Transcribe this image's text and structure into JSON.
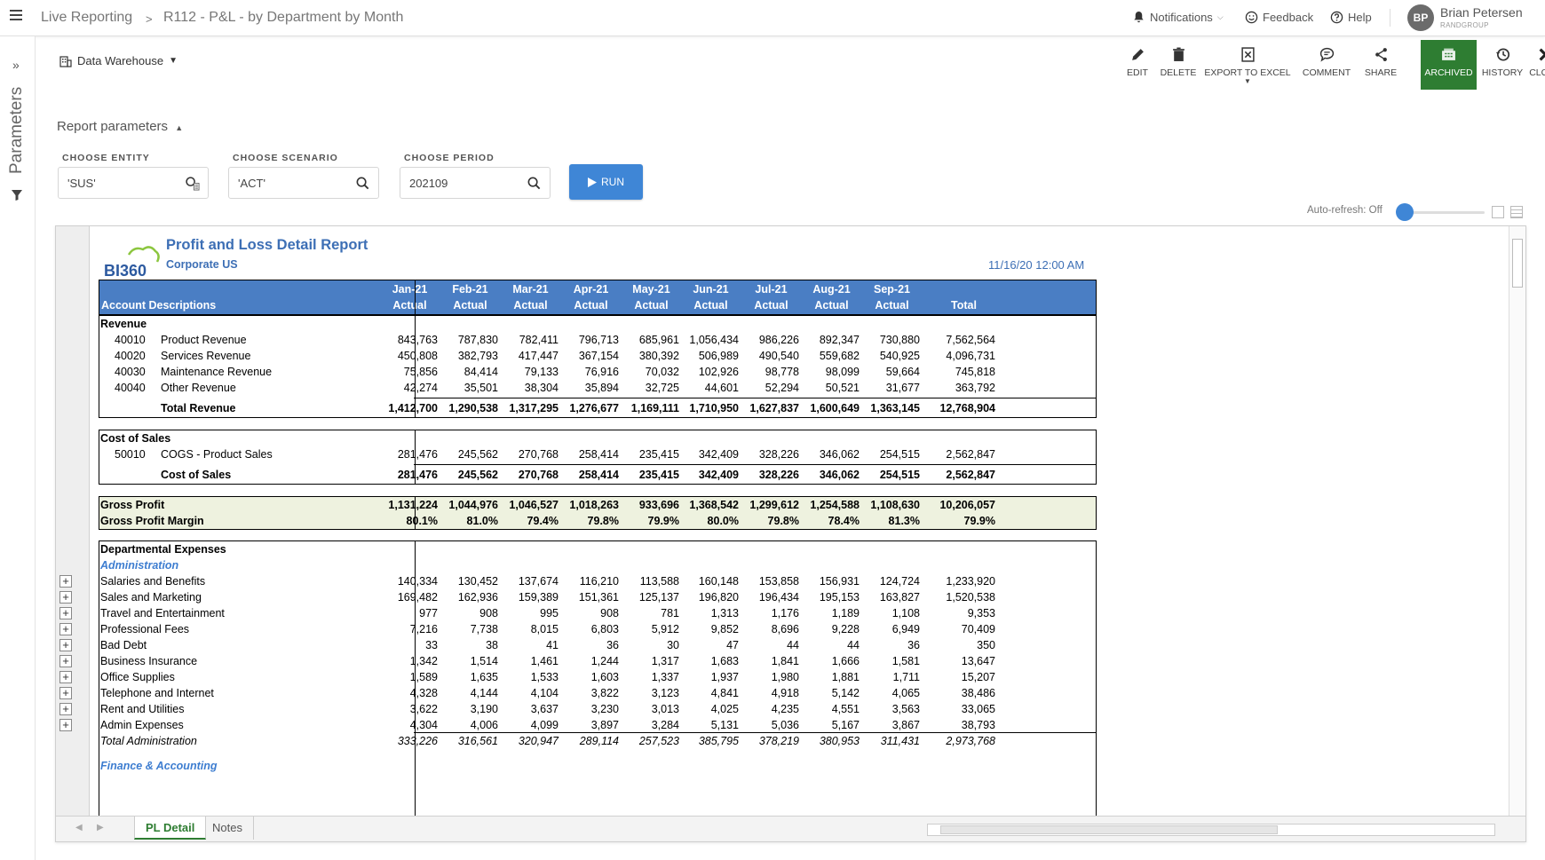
{
  "topbar": {
    "breadcrumb_root": "Live Reporting",
    "breadcrumb_sep": ">",
    "breadcrumb_current": "R112 - P&L - by Department by Month",
    "notifications": "Notifications",
    "feedback": "Feedback",
    "help": "Help",
    "user_initials": "BP",
    "user_name": "Brian Petersen",
    "user_org": "RANDGROUP"
  },
  "sidebar": {
    "label": "Parameters"
  },
  "toolbar": {
    "source": "Data Warehouse",
    "actions": [
      "EDIT",
      "DELETE",
      "EXPORT TO EXCEL",
      "COMMENT",
      "SHARE",
      "ARCHIVED",
      "HISTORY",
      "CLOSE"
    ]
  },
  "params": {
    "title": "Report parameters",
    "entity_label": "CHOOSE ENTITY",
    "entity_value": "'SUS'",
    "scenario_label": "CHOOSE SCENARIO",
    "scenario_value": "'ACT'",
    "period_label": "CHOOSE PERIOD",
    "period_value": "202109",
    "run_label": "RUN",
    "autorefresh": "Auto-refresh: Off"
  },
  "report": {
    "title": "Profit and Loss Detail Report",
    "subtitle": "Corporate US",
    "date": "11/16/20 12:00 AM",
    "logo_text": "BI360",
    "header_desc": "Account Descriptions",
    "months": [
      "Jan-21",
      "Feb-21",
      "Mar-21",
      "Apr-21",
      "May-21",
      "Jun-21",
      "Jul-21",
      "Aug-21",
      "Sep-21"
    ],
    "scenario": "Actual",
    "total_label": "Total",
    "revenue_title": "Revenue",
    "revenue_rows": [
      {
        "code": "40010",
        "name": "Product Revenue",
        "v": [
          "843,763",
          "787,830",
          "782,411",
          "796,713",
          "685,961",
          "1,056,434",
          "986,226",
          "892,347",
          "730,880",
          "7,562,564"
        ]
      },
      {
        "code": "40020",
        "name": "Services Revenue",
        "v": [
          "450,808",
          "382,793",
          "417,447",
          "367,154",
          "380,392",
          "506,989",
          "490,540",
          "559,682",
          "540,925",
          "4,096,731"
        ]
      },
      {
        "code": "40030",
        "name": "Maintenance Revenue",
        "v": [
          "75,856",
          "84,414",
          "79,133",
          "76,916",
          "70,032",
          "102,926",
          "98,778",
          "98,099",
          "59,664",
          "745,818"
        ]
      },
      {
        "code": "40040",
        "name": "Other Revenue",
        "v": [
          "42,274",
          "35,501",
          "38,304",
          "35,894",
          "32,725",
          "44,601",
          "52,294",
          "50,521",
          "31,677",
          "363,792"
        ]
      }
    ],
    "total_revenue": {
      "name": "Total Revenue",
      "v": [
        "1,412,700",
        "1,290,538",
        "1,317,295",
        "1,276,677",
        "1,169,111",
        "1,710,950",
        "1,627,837",
        "1,600,649",
        "1,363,145",
        "12,768,904"
      ]
    },
    "cos_title": "Cost of Sales",
    "cos_rows": [
      {
        "code": "50010",
        "name": "COGS - Product Sales",
        "v": [
          "281,476",
          "245,562",
          "270,768",
          "258,414",
          "235,415",
          "342,409",
          "328,226",
          "346,062",
          "254,515",
          "2,562,847"
        ]
      }
    ],
    "total_cos": {
      "name": "Cost of Sales",
      "v": [
        "281,476",
        "245,562",
        "270,768",
        "258,414",
        "235,415",
        "342,409",
        "328,226",
        "346,062",
        "254,515",
        "2,562,847"
      ]
    },
    "gross_profit": {
      "name": "Gross Profit",
      "v": [
        "1,131,224",
        "1,044,976",
        "1,046,527",
        "1,018,263",
        "933,696",
        "1,368,542",
        "1,299,612",
        "1,254,588",
        "1,108,630",
        "10,206,057"
      ]
    },
    "gross_margin": {
      "name": "Gross Profit Margin",
      "v": [
        "80.1%",
        "81.0%",
        "79.4%",
        "79.8%",
        "79.9%",
        "80.0%",
        "79.8%",
        "78.4%",
        "81.3%",
        "79.9%"
      ]
    },
    "dept_title": "Departmental Expenses",
    "admin_title": "Administration",
    "admin_rows": [
      {
        "name": "Salaries and Benefits",
        "v": [
          "140,334",
          "130,452",
          "137,674",
          "116,210",
          "113,588",
          "160,148",
          "153,858",
          "156,931",
          "124,724",
          "1,233,920"
        ]
      },
      {
        "name": "Sales and Marketing",
        "v": [
          "169,482",
          "162,936",
          "159,389",
          "151,361",
          "125,137",
          "196,820",
          "196,434",
          "195,153",
          "163,827",
          "1,520,538"
        ]
      },
      {
        "name": "Travel and Entertainment",
        "v": [
          "977",
          "908",
          "995",
          "908",
          "781",
          "1,313",
          "1,176",
          "1,189",
          "1,108",
          "9,353"
        ]
      },
      {
        "name": "Professional Fees",
        "v": [
          "7,216",
          "7,738",
          "8,015",
          "6,803",
          "5,912",
          "9,852",
          "8,696",
          "9,228",
          "6,949",
          "70,409"
        ]
      },
      {
        "name": "Bad Debt",
        "v": [
          "33",
          "38",
          "41",
          "36",
          "30",
          "47",
          "44",
          "44",
          "36",
          "350"
        ]
      },
      {
        "name": "Business Insurance",
        "v": [
          "1,342",
          "1,514",
          "1,461",
          "1,244",
          "1,317",
          "1,683",
          "1,841",
          "1,666",
          "1,581",
          "13,647"
        ]
      },
      {
        "name": "Office Supplies",
        "v": [
          "1,589",
          "1,635",
          "1,533",
          "1,603",
          "1,337",
          "1,937",
          "1,980",
          "1,881",
          "1,711",
          "15,207"
        ]
      },
      {
        "name": "Telephone and Internet",
        "v": [
          "4,328",
          "4,144",
          "4,104",
          "3,822",
          "3,123",
          "4,841",
          "4,918",
          "5,142",
          "4,065",
          "38,486"
        ]
      },
      {
        "name": "Rent and Utilities",
        "v": [
          "3,622",
          "3,190",
          "3,637",
          "3,230",
          "3,013",
          "4,025",
          "4,235",
          "4,551",
          "3,563",
          "33,065"
        ]
      },
      {
        "name": "Admin Expenses",
        "v": [
          "4,304",
          "4,006",
          "4,099",
          "3,897",
          "3,284",
          "5,131",
          "5,036",
          "5,167",
          "3,867",
          "38,793"
        ]
      }
    ],
    "total_admin": {
      "name": "Total Administration",
      "v": [
        "333,226",
        "316,561",
        "320,947",
        "289,114",
        "257,523",
        "385,795",
        "378,219",
        "380,953",
        "311,431",
        "2,973,768"
      ]
    },
    "fa_title": "Finance & Accounting"
  },
  "tabs": [
    "PL Detail",
    "Notes"
  ],
  "colors": {
    "header_blue": "#4a7ec4",
    "accent_green": "#2e7d32",
    "run_blue": "#3f86d6",
    "gp_fill": "#eef2df"
  }
}
